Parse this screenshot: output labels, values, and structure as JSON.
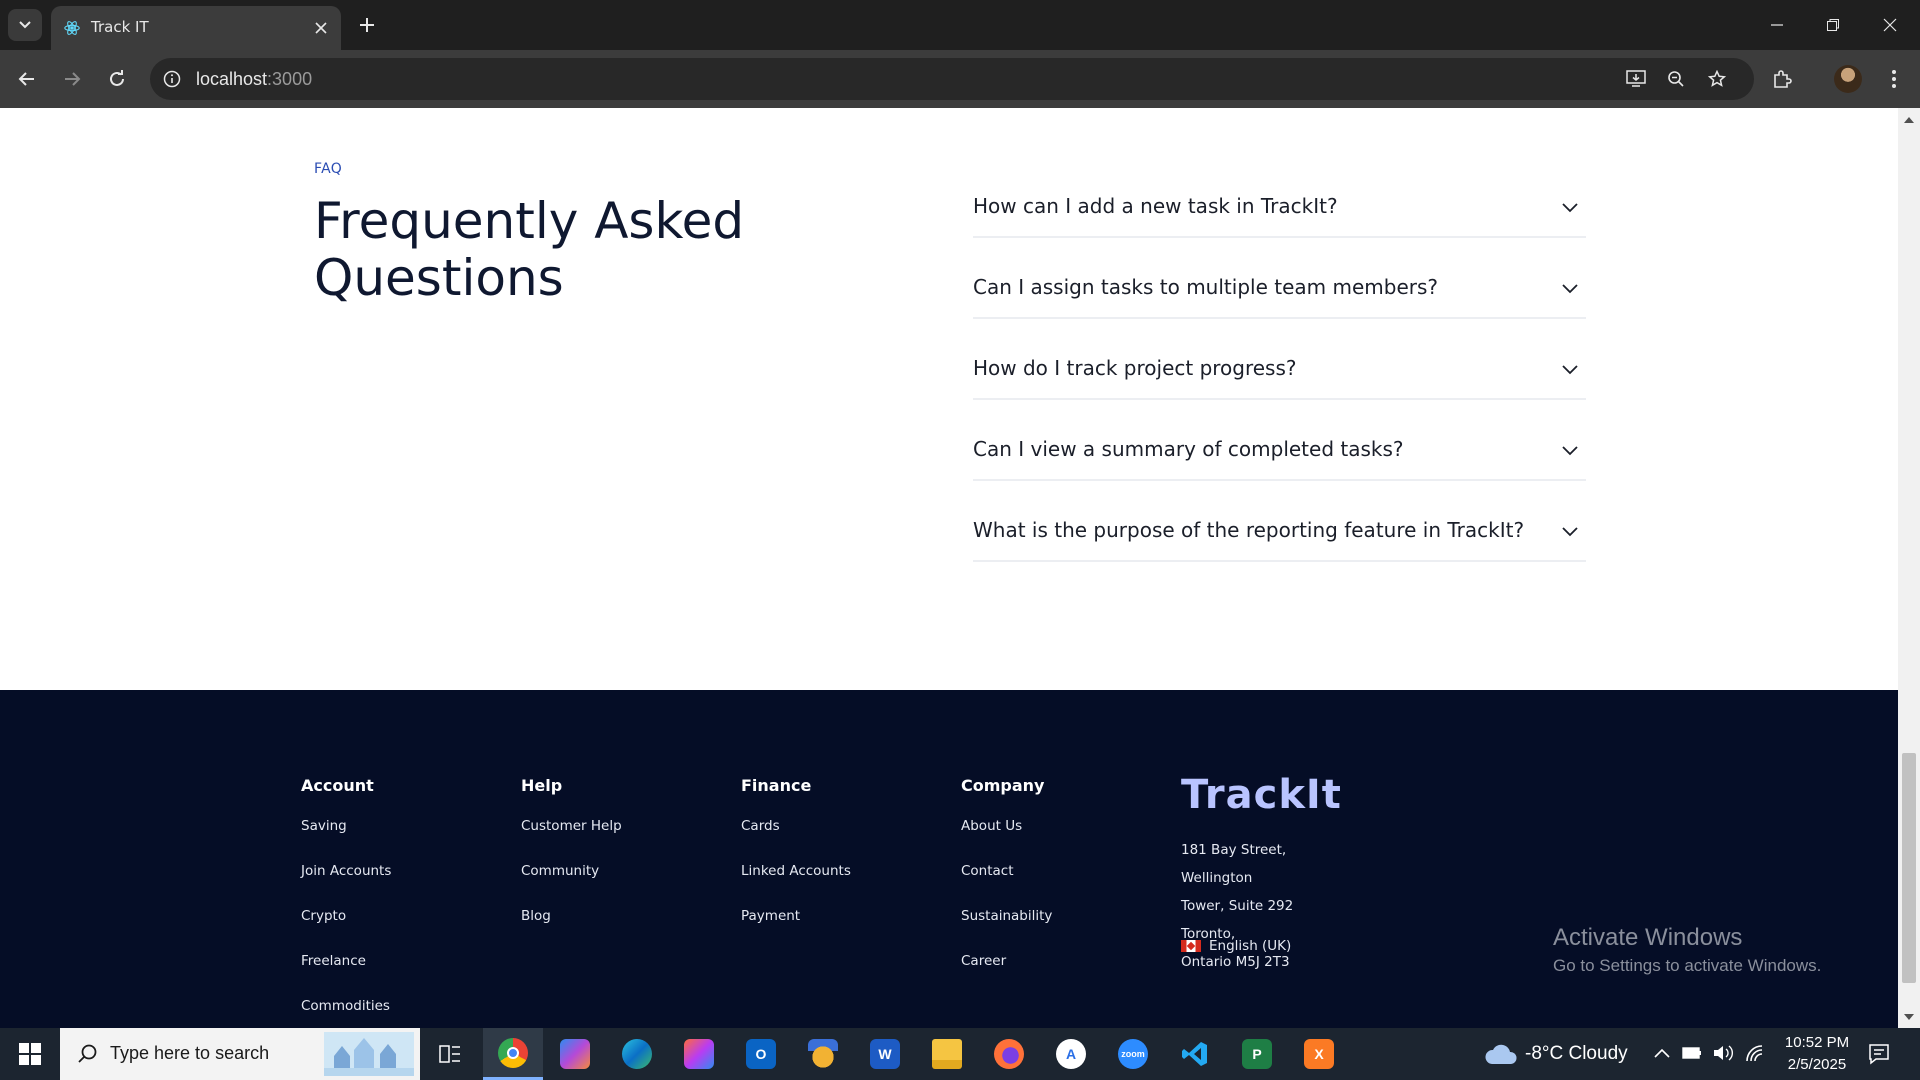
{
  "browser": {
    "tab_title": "Track IT",
    "url_host": "localhost",
    "url_port": ":3000"
  },
  "faq": {
    "label": "FAQ",
    "title": "Frequently Asked Questions",
    "questions": [
      "How can I add a new task in TrackIt?",
      "Can I assign tasks to multiple team members?",
      "How do I track project progress?",
      "Can I view a summary of completed tasks?",
      "What is the purpose of the reporting feature in TrackIt?"
    ]
  },
  "footer": {
    "columns": [
      {
        "heading": "Account",
        "links": [
          "Saving",
          "Join Accounts",
          "Crypto",
          "Freelance",
          "Commodities"
        ]
      },
      {
        "heading": "Help",
        "links": [
          "Customer Help",
          "Community",
          "Blog"
        ]
      },
      {
        "heading": "Finance",
        "links": [
          "Cards",
          "Linked Accounts",
          "Payment"
        ]
      },
      {
        "heading": "Company",
        "links": [
          "About Us",
          "Contact",
          "Sustainability",
          "Career"
        ]
      }
    ],
    "brand": "TrackIt",
    "address_lines": [
      "181 Bay Street, Wellington",
      "Tower, Suite 292 Toronto,",
      "Ontario M5J 2T3"
    ],
    "language": "English (UK)"
  },
  "watermark": {
    "title": "Activate Windows",
    "subtitle": "Go to Settings to activate Windows."
  },
  "taskbar": {
    "search_placeholder": "Type here to search",
    "weather": "-8°C  Cloudy",
    "time": "10:52 PM",
    "date": "2/5/2025"
  }
}
